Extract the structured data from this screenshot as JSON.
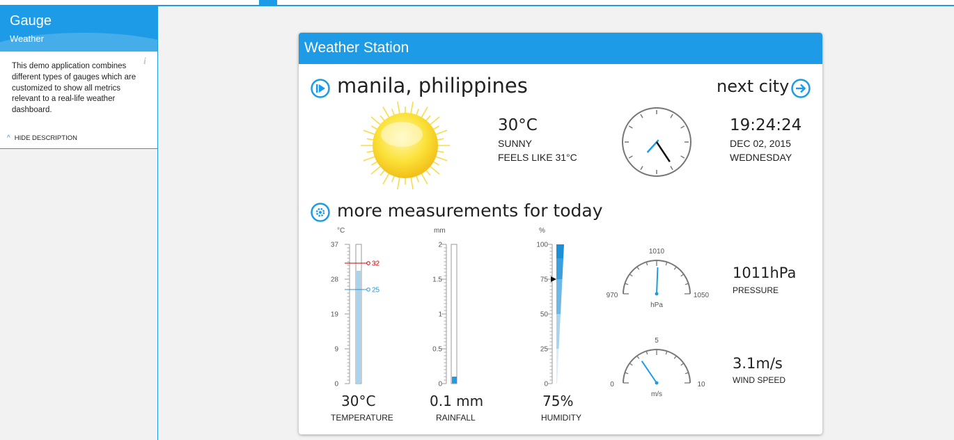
{
  "sidebar": {
    "title": "Gauge",
    "subtitle": "Weather",
    "description": "This demo application combines different types of gauges which are customized to show all metrics relevant to a real-life weather dashboard.",
    "hide_label": "HIDE DESCRIPTION",
    "info_icon": "i"
  },
  "card": {
    "title": "Weather Station",
    "city": "manila, philippines",
    "next_city": "next city",
    "current": {
      "temp": "30°C",
      "condition": "SUNNY",
      "feels_like": "FEELS LIKE 31°C"
    },
    "clock": {
      "time": "19:24:24",
      "date": "DEC 02, 2015",
      "day": "WEDNESDAY",
      "hours": 19,
      "minutes": 24,
      "seconds": 24
    },
    "measurements_title": "more measurements for today",
    "temperature": {
      "unit": "°C",
      "ticks": [
        "37",
        "28",
        "19",
        "9",
        "0"
      ],
      "min": 0,
      "max": 37,
      "value": 30,
      "high": 32,
      "low": 25,
      "high_label": "32",
      "low_label": "25",
      "readout": "30°C",
      "label": "TEMPERATURE"
    },
    "rainfall": {
      "unit": "mm",
      "ticks": [
        "2",
        "1.5",
        "1",
        "0.5",
        "0"
      ],
      "min": 0,
      "max": 2,
      "value": 0.1,
      "readout": "0.1 mm",
      "label": "RAINFALL"
    },
    "humidity": {
      "unit": "%",
      "ticks": [
        "100",
        "75",
        "50",
        "25",
        "0"
      ],
      "min": 0,
      "max": 100,
      "value": 75,
      "readout": "75%",
      "label": "HUMIDITY"
    },
    "pressure": {
      "min_label": "970",
      "mid_label": "1010",
      "max_label": "1050",
      "unit": "hPa",
      "min": 970,
      "max": 1050,
      "value": 1011,
      "readout": "1011hPa",
      "label": "PRESSURE"
    },
    "wind": {
      "min_label": "0",
      "mid_label": "5",
      "max_label": "10",
      "unit": "m/s",
      "min": 0,
      "max": 10,
      "value": 3.1,
      "readout": "3.1m/s",
      "label": "WIND SPEED"
    }
  },
  "colors": {
    "accent": "#1d9be6",
    "high": "#cc0000",
    "low": "#1d9be6",
    "bar_light": "#a9d4ee"
  },
  "icons": {
    "play": "play-circle-icon",
    "next": "arrow-right-circle-icon",
    "settings": "gear-circle-icon",
    "sun": "sun-icon"
  }
}
